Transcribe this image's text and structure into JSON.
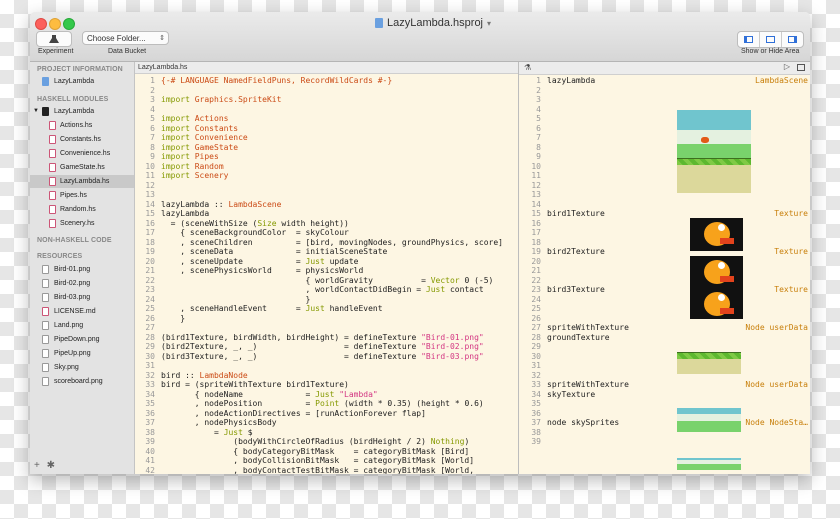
{
  "window": {
    "title": "LazyLambda.hsproj",
    "toolbar": {
      "experiment_label": "Experiment",
      "data_bucket_label": "Data Bucket",
      "data_bucket_value": "Choose Folder...",
      "show_hide_label": "Show or Hide Area"
    }
  },
  "sidebar": {
    "project_header": "PROJECT INFORMATION",
    "project_item": "LazyLambda",
    "haskell_header": "HASKELL MODULES",
    "haskell_root": "LazyLambda",
    "modules": [
      "Actions.hs",
      "Constants.hs",
      "Convenience.hs",
      "GameState.hs",
      "LazyLambda.hs",
      "Pipes.hs",
      "Random.hs",
      "Scenery.hs"
    ],
    "selected_module": "LazyLambda.hs",
    "non_haskell_header": "NON-HASKELL CODE",
    "resources_header": "RESOURCES",
    "resources": [
      "Bird-01.png",
      "Bird-02.png",
      "Bird-03.png",
      "LICENSE.md",
      "Land.png",
      "PipeDown.png",
      "PipeUp.png",
      "Sky.png",
      "scoreboard.png"
    ],
    "bottom_add": "+",
    "bottom_gear": "✱"
  },
  "editor": {
    "tab": "LazyLambda.hs",
    "lines": [
      {
        "n": "1",
        "t": "{-# LANGUAGE NamedFieldPuns, RecordWildCards #-}"
      },
      {
        "n": "2",
        "t": ""
      },
      {
        "n": "3",
        "t": "import Graphics.SpriteKit"
      },
      {
        "n": "4",
        "t": ""
      },
      {
        "n": "5",
        "t": "import Actions"
      },
      {
        "n": "6",
        "t": "import Constants"
      },
      {
        "n": "7",
        "t": "import Convenience"
      },
      {
        "n": "8",
        "t": "import GameState"
      },
      {
        "n": "9",
        "t": "import Pipes"
      },
      {
        "n": "10",
        "t": "import Random"
      },
      {
        "n": "11",
        "t": "import Scenery"
      },
      {
        "n": "12",
        "t": ""
      },
      {
        "n": "13",
        "t": ""
      },
      {
        "n": "14",
        "t": "lazyLambda :: LambdaScene"
      },
      {
        "n": "15",
        "t": "lazyLambda"
      },
      {
        "n": "16",
        "t": "  = (sceneWithSize (Size width height))"
      },
      {
        "n": "17",
        "t": "    { sceneBackgroundColor  = skyColour"
      },
      {
        "n": "18",
        "t": "    , sceneChildren         = [bird, movingNodes, groundPhysics, score]"
      },
      {
        "n": "19",
        "t": "    , sceneData             = initialSceneState"
      },
      {
        "n": "20",
        "t": "    , sceneUpdate           = Just update"
      },
      {
        "n": "21",
        "t": "    , scenePhysicsWorld     = physicsWorld"
      },
      {
        "n": "22",
        "t": "                              { worldGravity          = Vector 0 (-5)"
      },
      {
        "n": "23",
        "t": "                              , worldContactDidBegin = Just contact"
      },
      {
        "n": "24",
        "t": "                              }"
      },
      {
        "n": "25",
        "t": "    , sceneHandleEvent      = Just handleEvent"
      },
      {
        "n": "26",
        "t": "    }"
      },
      {
        "n": "27",
        "t": ""
      },
      {
        "n": "28",
        "t": "(bird1Texture, birdWidth, birdHeight) = defineTexture \"Bird-01.png\""
      },
      {
        "n": "29",
        "t": "(bird2Texture, _, _)                  = defineTexture \"Bird-02.png\""
      },
      {
        "n": "30",
        "t": "(bird3Texture, _, _)                  = defineTexture \"Bird-03.png\""
      },
      {
        "n": "31",
        "t": ""
      },
      {
        "n": "32",
        "t": "bird :: LambdaNode"
      },
      {
        "n": "33",
        "t": "bird = (spriteWithTexture bird1Texture)"
      },
      {
        "n": "34",
        "t": "       { nodeName             = Just \"Lambda\""
      },
      {
        "n": "35",
        "t": "       , nodePosition         = Point (width * 0.35) (height * 0.6)"
      },
      {
        "n": "36",
        "t": "       , nodeActionDirectives = [runActionForever flap]"
      },
      {
        "n": "37",
        "t": "       , nodePhysicsBody"
      },
      {
        "n": "38",
        "t": "           = Just $"
      },
      {
        "n": "39",
        "t": "               (bodyWithCircleOfRadius (birdHeight / 2) Nothing)"
      },
      {
        "n": "40",
        "t": "               { bodyCategoryBitMask    = categoryBitMask [Bird]"
      },
      {
        "n": "41",
        "t": "               , bodyCollisionBitMask   = categoryBitMask [World]"
      },
      {
        "n": "42",
        "t": "               , bodyContactTestBitMask = categoryBitMask [World,"
      }
    ]
  },
  "results": {
    "lines": [
      {
        "n": "1",
        "t": "lazyLambda",
        "type": "LambdaScene"
      },
      {
        "n": "2",
        "t": "",
        "type": ""
      },
      {
        "n": "3",
        "t": "",
        "type": ""
      },
      {
        "n": "4",
        "t": "",
        "type": ""
      },
      {
        "n": "5",
        "t": "",
        "type": ""
      },
      {
        "n": "6",
        "t": "",
        "type": ""
      },
      {
        "n": "7",
        "t": "",
        "type": ""
      },
      {
        "n": "8",
        "t": "",
        "type": ""
      },
      {
        "n": "9",
        "t": "",
        "type": ""
      },
      {
        "n": "10",
        "t": "",
        "type": ""
      },
      {
        "n": "11",
        "t": "",
        "type": ""
      },
      {
        "n": "12",
        "t": "",
        "type": ""
      },
      {
        "n": "13",
        "t": "",
        "type": ""
      },
      {
        "n": "14",
        "t": "",
        "type": ""
      },
      {
        "n": "15",
        "t": "bird1Texture",
        "type": "Texture"
      },
      {
        "n": "16",
        "t": "",
        "type": ""
      },
      {
        "n": "17",
        "t": "",
        "type": ""
      },
      {
        "n": "18",
        "t": "",
        "type": ""
      },
      {
        "n": "19",
        "t": "bird2Texture",
        "type": "Texture"
      },
      {
        "n": "20",
        "t": "",
        "type": ""
      },
      {
        "n": "21",
        "t": "",
        "type": ""
      },
      {
        "n": "22",
        "t": "",
        "type": ""
      },
      {
        "n": "23",
        "t": "bird3Texture",
        "type": "Texture"
      },
      {
        "n": "24",
        "t": "",
        "type": ""
      },
      {
        "n": "25",
        "t": "",
        "type": ""
      },
      {
        "n": "26",
        "t": "",
        "type": ""
      },
      {
        "n": "27",
        "t": "spriteWithTexture\ngroundTexture",
        "type": "Node userData"
      },
      {
        "n": "28",
        "t": "",
        "type": ""
      },
      {
        "n": "29",
        "t": "",
        "type": ""
      },
      {
        "n": "30",
        "t": "",
        "type": ""
      },
      {
        "n": "31",
        "t": "",
        "type": ""
      },
      {
        "n": "32",
        "t": "",
        "type": ""
      },
      {
        "n": "33",
        "t": "spriteWithTexture\nskyTexture",
        "type": "Node userData"
      },
      {
        "n": "34",
        "t": "",
        "type": ""
      },
      {
        "n": "35",
        "t": "",
        "type": ""
      },
      {
        "n": "36",
        "t": "",
        "type": ""
      },
      {
        "n": "37",
        "t": "node skySprites",
        "type": "Node NodeSta…"
      },
      {
        "n": "38",
        "t": "",
        "type": ""
      },
      {
        "n": "39",
        "t": "",
        "type": ""
      }
    ]
  },
  "colors": {
    "keyword": "#859900",
    "module": "#cb4b16",
    "string": "#d33682",
    "number": "#6c71c4",
    "type": "#c87f0a",
    "accent": "#2f6fd8"
  }
}
